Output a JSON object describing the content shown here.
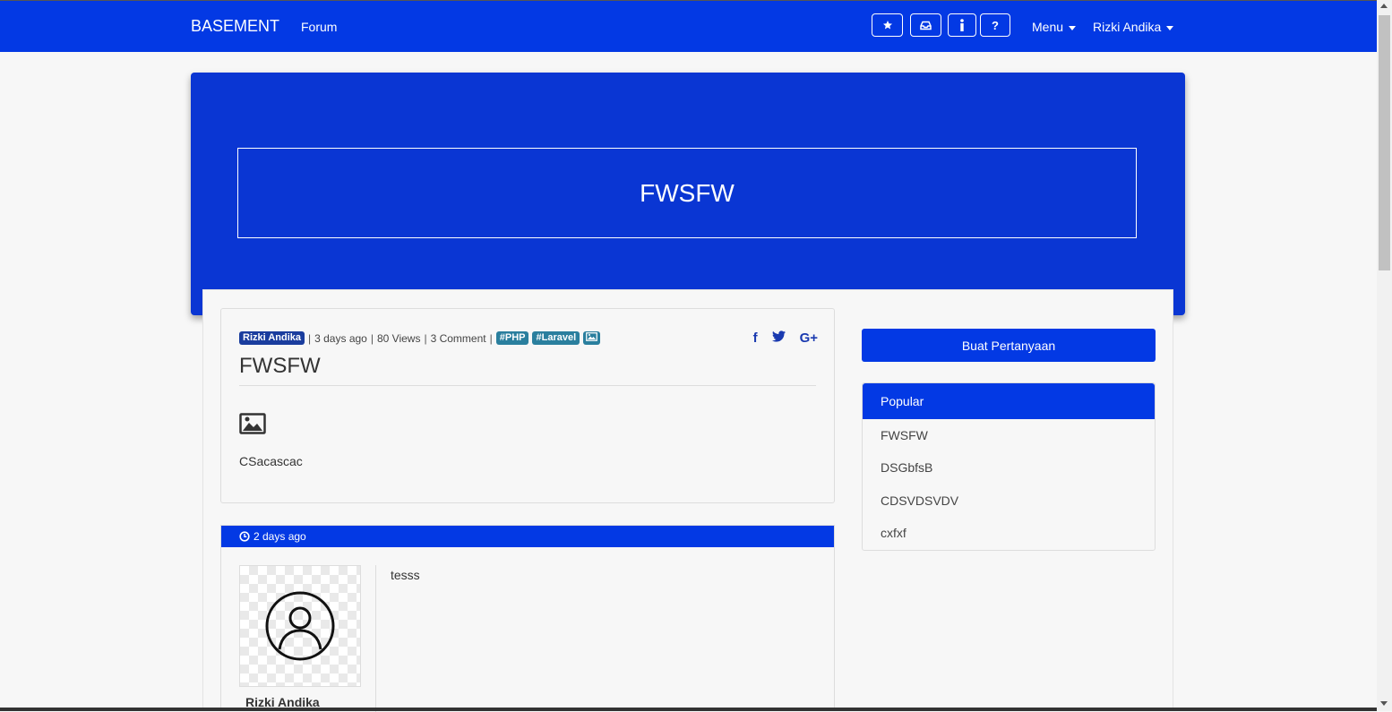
{
  "navbar": {
    "brand": "BASEMENT",
    "forum_link": "Forum",
    "icon_buttons": [
      "star-icon",
      "inbox-icon",
      "info-icon",
      "question-icon"
    ],
    "menu_label": "Menu",
    "user_label": "Rizki Andika"
  },
  "hero": {
    "title": "FWSFW"
  },
  "question": {
    "author": "Rizki Andika",
    "time": "3 days ago",
    "views": "80 Views",
    "comments": "3 Comment",
    "tags": [
      "#PHP",
      "#Laravel"
    ],
    "share_icons": [
      "facebook-icon",
      "twitter-icon",
      "google-plus-icon"
    ],
    "title": "FWSFW",
    "body": "CSacascac"
  },
  "comment": {
    "time": "2 days ago",
    "author": "Rizki Andika",
    "body": "tesss"
  },
  "sidebar": {
    "ask_button": "Buat Pertanyaan",
    "popular_title": "Popular",
    "popular_items": [
      "FWSFW",
      "DSGbfsB",
      "CDSVDSVDV",
      "cxfxf"
    ]
  },
  "colors": {
    "primary": "#0339e4",
    "hero": "#0a36d3",
    "tag": "#2a7f9e",
    "user_badge": "#1a3d9e"
  }
}
